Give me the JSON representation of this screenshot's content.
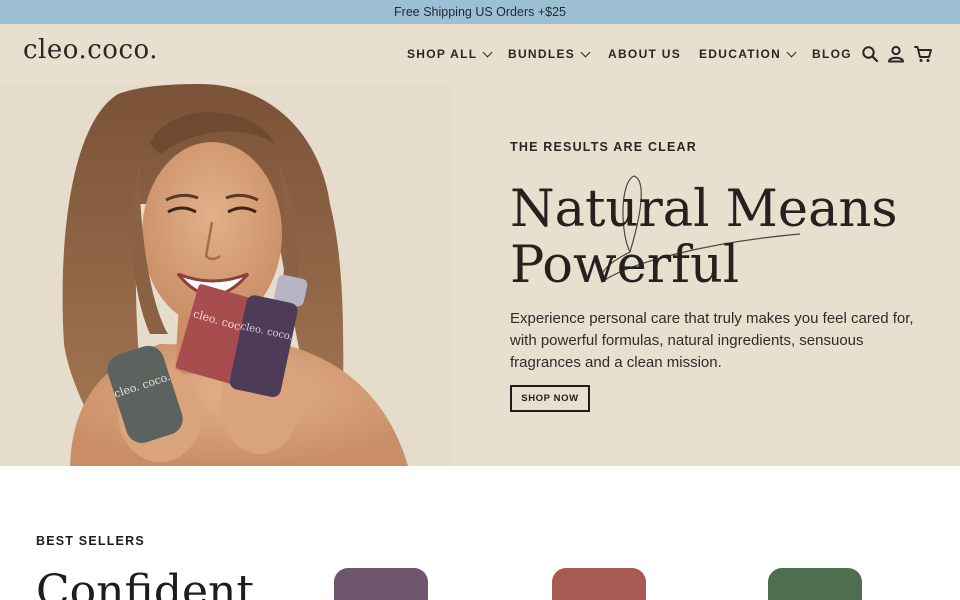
{
  "announcement": "Free Shipping US Orders +$25",
  "brand": {
    "logo": "cleo.coco."
  },
  "nav": {
    "shop_all": "SHOP ALL",
    "bundles": "BUNDLES",
    "about_us": "ABOUT US",
    "education": "EDUCATION",
    "blog": "BLOG"
  },
  "header_icons": [
    "search-icon",
    "account-icon",
    "cart-icon"
  ],
  "hero": {
    "eyebrow": "THE RESULTS ARE CLEAR",
    "headline": "Natural Means Powerful",
    "description": "Experience personal care that truly makes you feel cared for, with powerful formulas, natural ingredients, sensuous fragrances and a clean mission.",
    "cta": "SHOP NOW",
    "product_labels": {
      "left": "cleo. coco.",
      "center": "cleo. coco.",
      "right": "cleo. coco."
    }
  },
  "best_sellers": {
    "label": "BEST SELLERS",
    "heading": "Confident"
  },
  "colors": {
    "announcement_bg": "#9dbfd3",
    "hero_bg": "#e9dfcf",
    "text": "#1f1d1b",
    "product_purple": "#6e566f",
    "product_red": "#a65a52",
    "product_green": "#4d6e4f"
  }
}
